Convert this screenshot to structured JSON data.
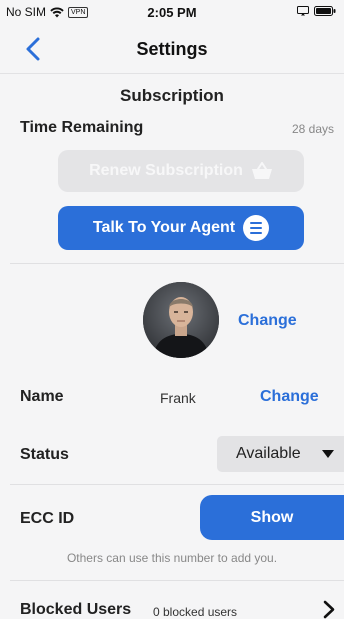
{
  "status_bar": {
    "carrier": "No SIM",
    "vpn_label": "VPN",
    "time": "2:05 PM"
  },
  "nav": {
    "title": "Settings",
    "back_icon": "chevron-left-icon"
  },
  "subscription": {
    "section_title": "Subscription",
    "time_remaining_label": "Time Remaining",
    "time_remaining_value": "28 days",
    "renew_button_label": "Renew Subscription",
    "renew_icon": "basket-icon",
    "agent_button_label": "Talk To Your Agent",
    "agent_icon": "chat-bubble-icon"
  },
  "profile": {
    "avatar_change_label": "Change",
    "name_label": "Name",
    "name_value": "Frank",
    "name_change_label": "Change",
    "status_label": "Status",
    "status_value": "Available",
    "ecc_label": "ECC ID",
    "show_button_label": "Show",
    "ecc_hint": "Others can use this number to add you."
  },
  "blocked": {
    "label": "Blocked Users",
    "count_text": "0 blocked users"
  },
  "colors": {
    "accent": "#2b6fd9",
    "background": "#f5f5f6",
    "disabled_button": "#e4e4e6",
    "muted_text": "#888888"
  }
}
